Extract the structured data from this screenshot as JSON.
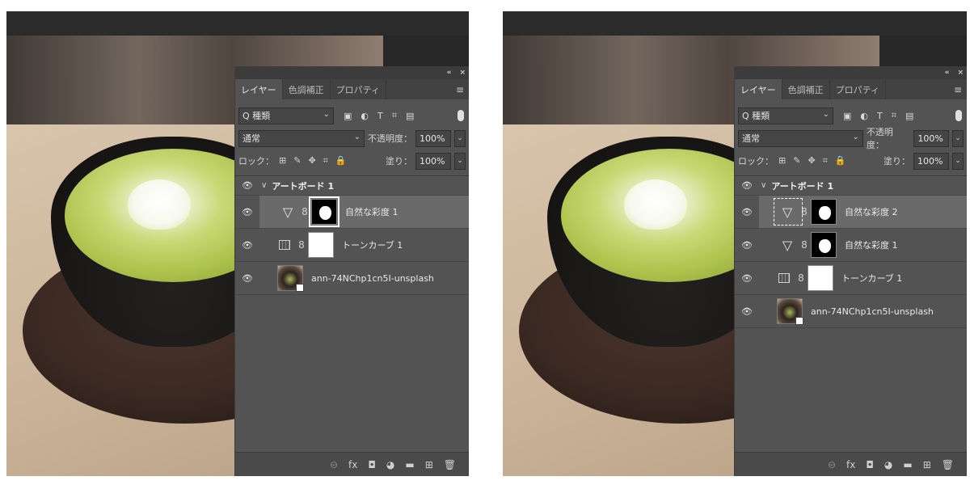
{
  "panels": [
    {
      "panel_top": {
        "collapse": "«",
        "close": "×"
      },
      "tabs": [
        "レイヤー",
        "色調補正",
        "プロパティ"
      ],
      "menu_icon": "≡",
      "filter": {
        "kind_label": "Q 種類",
        "icons": [
          "image-icon",
          "adjustment-icon",
          "type-icon",
          "shape-icon",
          "smartobject-icon"
        ],
        "icon_glyphs": [
          "▣",
          "◐",
          "T",
          "⌗",
          "▤"
        ]
      },
      "blend_mode": "通常",
      "opacity_label": "不透明度：",
      "opacity_value": "100%",
      "lock_label": "ロック：",
      "lock_glyphs": [
        "⊞",
        "✎",
        "✥",
        "⌗",
        "🔒"
      ],
      "fill_label": "塗り：",
      "fill_value": "100%",
      "group": {
        "name": "アートボード 1"
      },
      "layers": [
        {
          "name": "自然な彩度 1",
          "type": "vibrance",
          "mask": "shape",
          "selected": true,
          "mask_active": true
        },
        {
          "name": "トーンカーブ 1",
          "type": "curves",
          "mask": "white",
          "selected": false,
          "mask_active": false
        },
        {
          "name": "ann-74NChp1cn5I-unsplash",
          "type": "smart-object",
          "selected": false
        }
      ],
      "bottom_icons": [
        "link-icon",
        "fx-icon",
        "mask-icon",
        "fill-adjustment-icon",
        "folder-icon",
        "new-layer-icon",
        "trash-icon"
      ],
      "bottom_glyphs": [
        "⊖",
        "fx",
        "◘",
        "◕",
        "▬",
        "⊞",
        "🗑"
      ]
    },
    {
      "panel_top": {
        "collapse": "«",
        "close": "×"
      },
      "tabs": [
        "レイヤー",
        "色調補正",
        "プロパティ"
      ],
      "menu_icon": "≡",
      "filter": {
        "kind_label": "Q 種類",
        "icons": [
          "image-icon",
          "adjustment-icon",
          "type-icon",
          "shape-icon",
          "smartobject-icon"
        ],
        "icon_glyphs": [
          "▣",
          "◐",
          "T",
          "⌗",
          "▤"
        ]
      },
      "blend_mode": "通常",
      "opacity_label": "不透明度：",
      "opacity_value": "100%",
      "lock_label": "ロック：",
      "lock_glyphs": [
        "⊞",
        "✎",
        "✥",
        "⌗",
        "🔒"
      ],
      "fill_label": "塗り：",
      "fill_value": "100%",
      "group": {
        "name": "アートボード 1"
      },
      "layers": [
        {
          "name": "自然な彩度 2",
          "type": "vibrance",
          "mask": "shape",
          "selected": true,
          "mask_active": false,
          "icon_selected": true
        },
        {
          "name": "自然な彩度 1",
          "type": "vibrance",
          "mask": "shape",
          "selected": false,
          "mask_active": false
        },
        {
          "name": "トーンカーブ 1",
          "type": "curves",
          "mask": "white",
          "selected": false,
          "mask_active": false
        },
        {
          "name": "ann-74NChp1cn5I-unsplash",
          "type": "smart-object",
          "selected": false
        }
      ],
      "bottom_icons": [
        "link-icon",
        "fx-icon",
        "mask-icon",
        "fill-adjustment-icon",
        "folder-icon",
        "new-layer-icon",
        "trash-icon"
      ],
      "bottom_glyphs": [
        "⊖",
        "fx",
        "◘",
        "◕",
        "▬",
        "⊞",
        "🗑"
      ]
    }
  ],
  "common": {
    "eye": "👁",
    "chain": "8",
    "group_caret": "∨",
    "dropdown_caret": "⌄",
    "vibrance_glyph": "▽"
  }
}
